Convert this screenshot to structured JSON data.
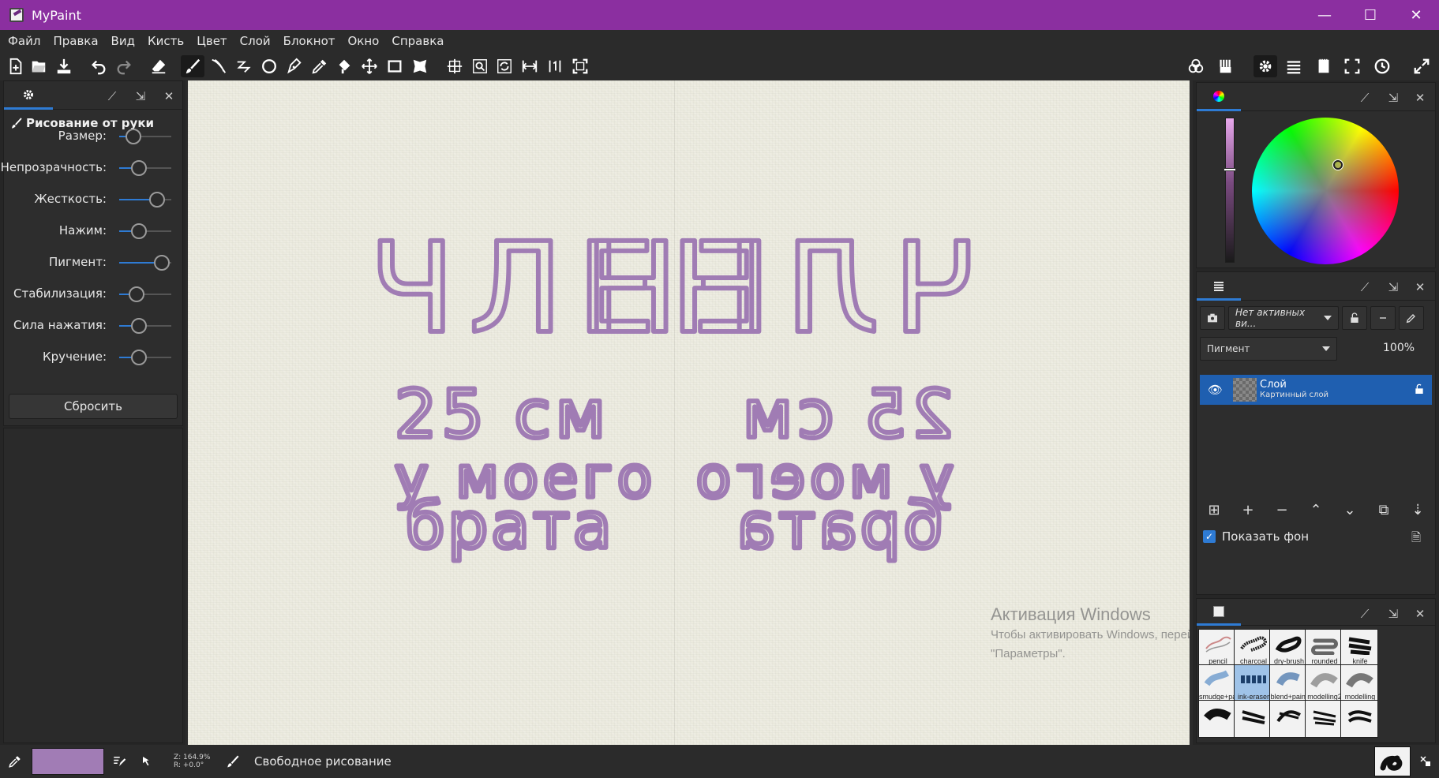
{
  "window": {
    "title": "MyPaint",
    "minimize": "—",
    "maximize": "☐",
    "close": "✕"
  },
  "menu": [
    "Файл",
    "Правка",
    "Вид",
    "Кисть",
    "Цвет",
    "Слой",
    "Блокнот",
    "Окно",
    "Справка"
  ],
  "toolbar_icons": [
    "new-file-icon",
    "open-file-icon",
    "save-icon",
    "undo-icon",
    "redo-icon",
    "eraser-mode-icon",
    "freehand-brush-icon",
    "inking-icon",
    "lines-icon",
    "ellipse-icon",
    "pen-icon",
    "color-picker-icon",
    "fill-icon",
    "pan-icon",
    "frame-icon",
    "symmetry-icon",
    "move-view-icon",
    "zoom-icon",
    "rotate-icon",
    "mirror-icon",
    "reset-view-icon",
    "fit-view-icon",
    "color-palette-icon",
    "brush-box-icon",
    "settings-icon",
    "layers-icon",
    "scratchpad-icon",
    "fullscreen-icon",
    "history-icon",
    "expand-icon"
  ],
  "left_panel": {
    "brush_mode": "Рисование от руки",
    "params": [
      {
        "label": "Размер:",
        "value": 0.28
      },
      {
        "label": "Непрозрачность:",
        "value": 0.38
      },
      {
        "label": "Жесткость:",
        "value": 0.72
      },
      {
        "label": "Нажим:",
        "value": 0.38
      },
      {
        "label": "Пигмент:",
        "value": 0.82
      },
      {
        "label": "Стабилизация:",
        "value": 0.34
      },
      {
        "label": "Сила нажатия:",
        "value": 0.38
      },
      {
        "label": "Кручение:",
        "value": 0.38
      }
    ],
    "reset_label": "Сбросить"
  },
  "canvas": {
    "lines_left": [
      "ЧЛЕН",
      "25 см",
      "у моего",
      "брата"
    ],
    "lines_right": [
      "ЧЛЕН",
      "25 см",
      "у моего",
      "брата"
    ],
    "stroke_color": "#a07cb4",
    "paper_color": "#ecebdf"
  },
  "watermark": {
    "title": "Активация Windows",
    "line1": "Чтобы активировать Windows, перейдите в раздел",
    "line2": "\"Параметры\"."
  },
  "layers": {
    "filter_placeholder": "Нет активных ви...",
    "blend_mode": "Пигмент",
    "opacity": "100%",
    "layer_name": "Слой",
    "layer_type": "Картинный слой",
    "show_background": "Показать фон"
  },
  "brushes": [
    {
      "name": "pencil"
    },
    {
      "name": "charcoal"
    },
    {
      "name": "dry-brush"
    },
    {
      "name": "rounded"
    },
    {
      "name": "knife"
    },
    {
      "name": "smudge+paint"
    },
    {
      "name": "ink-eraser"
    },
    {
      "name": "blend+paint"
    },
    {
      "name": "modelling2"
    },
    {
      "name": "modelling"
    },
    {
      "name": ""
    },
    {
      "name": ""
    },
    {
      "name": ""
    },
    {
      "name": ""
    },
    {
      "name": ""
    }
  ],
  "status": {
    "zoom": "Z: 164.9%",
    "rotation": "R: +0.0°",
    "mode": "Свободное рисование",
    "current_color": "#a17cb5"
  },
  "accent_color": "#2e7bd4",
  "titlebar_color": "#8b2fa0"
}
